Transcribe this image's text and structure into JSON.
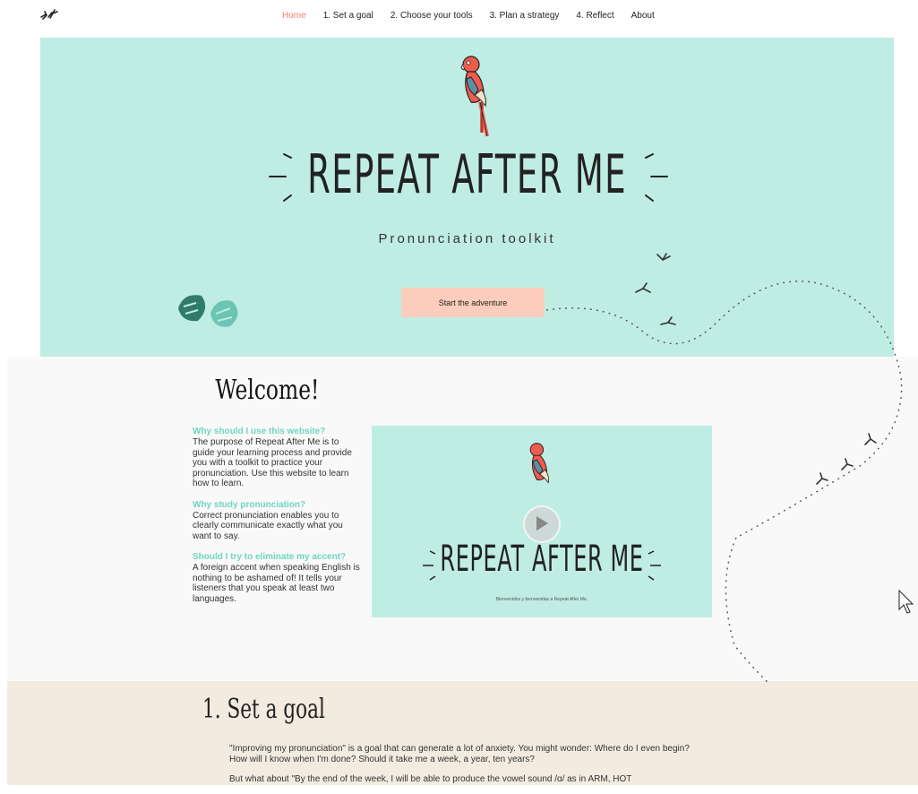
{
  "nav": {
    "logo_icon": "birds-icon",
    "items": [
      {
        "label": "Home",
        "active": true
      },
      {
        "label": "1. Set a goal",
        "active": false
      },
      {
        "label": "2. Choose your tools",
        "active": false
      },
      {
        "label": "3. Plan a strategy",
        "active": false
      },
      {
        "label": "4. Reflect",
        "active": false
      },
      {
        "label": "About",
        "active": false
      }
    ]
  },
  "hero": {
    "title": "REPEAT AFTER ME",
    "subtitle": "Pronunciation toolkit",
    "button_label": "Start the adventure"
  },
  "welcome": {
    "title": "Welcome!",
    "faq": [
      {
        "question": "Why should I use this website?",
        "answer": "The purpose of Repeat After Me is to guide your learning process and provide you with a toolkit to practice your pronunciation. Use this website to learn how to learn."
      },
      {
        "question": "Why study pronunciation?",
        "answer": "Correct pronunciation enables you to clearly communicate exactly what you want to say."
      },
      {
        "question": "Should I try to eliminate my accent?",
        "answer": "A foreign accent when speaking English is nothing to be ashamed of! It tells your listeners that you speak at least two languages."
      }
    ],
    "video": {
      "title": "REPEAT AFTER ME",
      "caption": "Bienvenidos y bienvenidas a Repeat After Me."
    }
  },
  "section1": {
    "title": "1. Set a goal",
    "paragraph1": "\"Improving my pronunciation\" is a goal that can generate a lot of anxiety. You might wonder: Where do I even begin? How will I know when I'm done? Should it take me a week, a year, ten years?",
    "paragraph2": "But what about \"By the end of the week, I will be able to produce the vowel sound /ɑ/ as in ARM, HOT"
  },
  "colors": {
    "hero_bg": "#bfede3",
    "accent_teal": "#6fd6c0",
    "nav_active": "#f5806e",
    "button_bg": "#fccdbc",
    "section_bg": "#f3ebe0"
  }
}
